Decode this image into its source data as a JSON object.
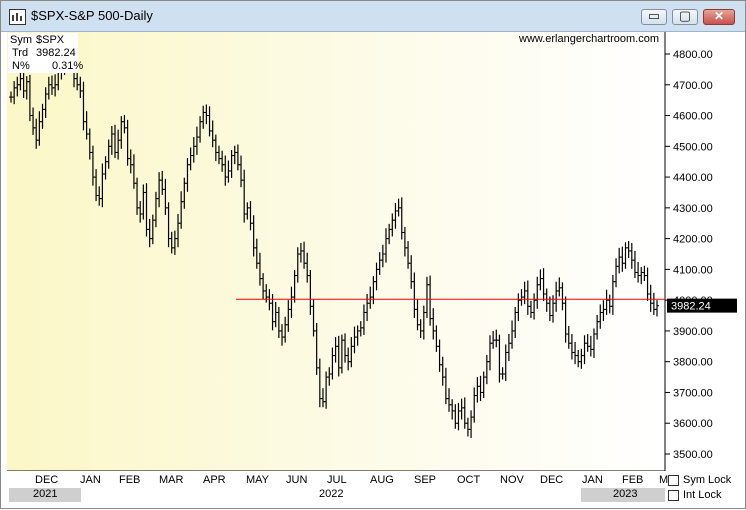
{
  "window": {
    "title": "$SPX-S&P 500-Daily",
    "controls": {
      "minimize": "▭",
      "maximize": "▢",
      "close": "✕"
    }
  },
  "info": {
    "sym_label": "Sym",
    "sym_value": "$SPX",
    "trd_label": "Trd",
    "trd_value": "3982.24",
    "n_label": "N%",
    "n_value": "0.31%"
  },
  "watermark": "www.erlangerchartroom.com",
  "footer": {
    "sym_lock": "Sym Lock",
    "int_lock": "Int Lock"
  },
  "colors": {
    "background_gradient_start": "#fbf7c7",
    "background_end": "#ffffff",
    "bars": "#000000",
    "horizontal_line": "#ff0000",
    "price_box": "#000000"
  },
  "chart_data": {
    "type": "ohlc",
    "title": "$SPX-S&P 500-Daily",
    "y_ticks": [
      "4800.00",
      "4700.00",
      "4600.00",
      "4500.00",
      "4400.00",
      "4300.00",
      "4200.00",
      "4100.00",
      "4000.00",
      "3900.00",
      "3800.00",
      "3700.00",
      "3600.00",
      "3500.00"
    ],
    "ylim": [
      3470,
      4850
    ],
    "month_labels": [
      "DEC",
      "JAN",
      "FEB",
      "MAR",
      "APR",
      "MAY",
      "JUN",
      "JUL",
      "AUG",
      "SEP",
      "OCT",
      "NOV",
      "DEC",
      "JAN",
      "FEB",
      "M"
    ],
    "year_labels": [
      "2021",
      "2022",
      "2023"
    ],
    "last_price": "3982.24",
    "horizontal_line": {
      "value": 4003,
      "start": "2022-04",
      "end": "2023-03",
      "color": "#ff0000"
    },
    "grid": false,
    "series": [
      {
        "values": [
          4660,
          4690,
          4700,
          4720,
          4680,
          4710,
          4600,
          4560,
          4520,
          4580,
          4620,
          4670,
          4700,
          4690,
          4700,
          4740,
          4760,
          4790,
          4780,
          4800,
          4720,
          4700,
          4680,
          4580,
          4540,
          4480,
          4400,
          4340,
          4330,
          4410,
          4450,
          4500,
          4540,
          4480,
          4520,
          4580,
          4560,
          4460,
          4440,
          4380,
          4300,
          4280,
          4350,
          4230,
          4200,
          4260,
          4330,
          4390,
          4360,
          4300,
          4200,
          4170,
          4200,
          4250,
          4320,
          4380,
          4440,
          4470,
          4500,
          4530,
          4580,
          4610,
          4600,
          4550,
          4520,
          4480,
          4460,
          4440,
          4400,
          4420,
          4470,
          4480,
          4440,
          4390,
          4280,
          4300,
          4250,
          4170,
          4120,
          4070,
          4030,
          4010,
          3990,
          3930,
          3960,
          3900,
          3880,
          3920,
          3970,
          4010,
          4080,
          4150,
          4160,
          4120,
          4080,
          3980,
          3900,
          3780,
          3680,
          3670,
          3750,
          3760,
          3820,
          3850,
          3780,
          3870,
          3820,
          3800,
          3850,
          3880,
          3900,
          3910,
          3960,
          3990,
          4010,
          4060,
          4100,
          4130,
          4150,
          4200,
          4230,
          4260,
          4290,
          4300,
          4220,
          4170,
          4120,
          4060,
          3970,
          3920,
          3900,
          3960,
          4050,
          3940,
          3900,
          3850,
          3790,
          3750,
          3680,
          3660,
          3640,
          3600,
          3640,
          3650,
          3600,
          3580,
          3620,
          3690,
          3720,
          3700,
          3750,
          3800,
          3860,
          3870,
          3870,
          3760,
          3760,
          3830,
          3860,
          3900,
          3960,
          4000,
          4010,
          4030,
          3980,
          3960,
          4000,
          4050,
          4070,
          4020,
          3990,
          3950,
          3990,
          4030,
          4040,
          3990,
          3890,
          3860,
          3830,
          3820,
          3800,
          3820,
          3860,
          3850,
          3840,
          3890,
          3930,
          3960,
          3970,
          4000,
          3980,
          4060,
          4110,
          4140,
          4120,
          4170,
          4160,
          4130,
          4090,
          4080,
          4090,
          4080,
          4020,
          3990,
          3970,
          3982
        ]
      }
    ]
  }
}
